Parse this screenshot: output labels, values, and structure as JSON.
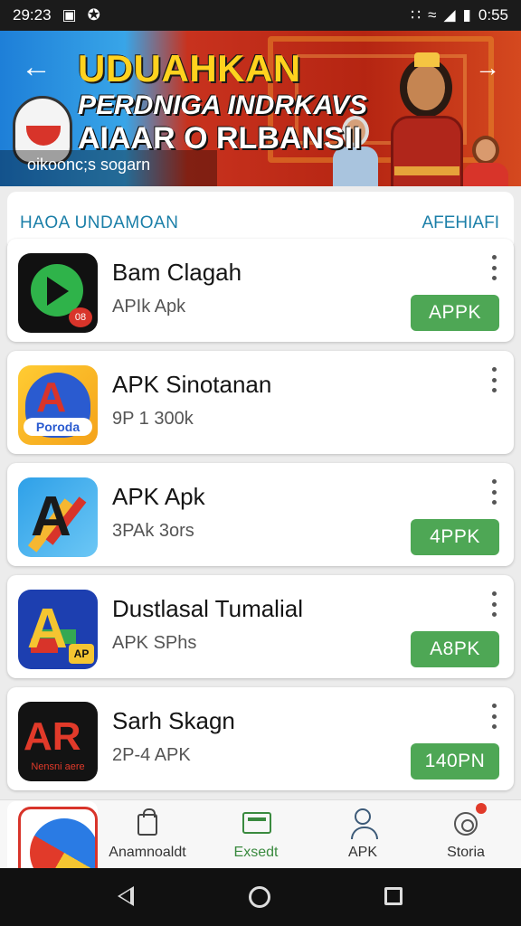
{
  "status_bar": {
    "time_left": "29:23",
    "time_right": "0:55"
  },
  "banner": {
    "headline": "UDUAHKAN",
    "line2": "PERDNIGA INDRKAVS",
    "line3": "AIAAR O RLBANSII",
    "caption": "oikoonc;s sogarn"
  },
  "section": {
    "title": "HAOA UNDAMOAN",
    "more": "AFEHIAFI"
  },
  "apps": [
    {
      "name": "Bam Clagah",
      "meta": "APIk Apk",
      "button": "APPK",
      "icon": "green-play-icon",
      "badge": "08"
    },
    {
      "name": "APK Sinotanan",
      "meta": "9P 1 300k",
      "button": "",
      "icon": "shield-a-icon",
      "badge": "Poroda"
    },
    {
      "name": "APK Apk",
      "meta": "3PAk 3ors",
      "button": "4PPK",
      "icon": "colorful-a-icon",
      "badge": ""
    },
    {
      "name": "Dustlasal Tumalial",
      "meta": "APK SPhs",
      "button": "A8PK",
      "icon": "blue-a-icon",
      "badge": "AP"
    },
    {
      "name": "Sarh Skagn",
      "meta": "2P-4 APK",
      "button": "140PN",
      "icon": "ar-icon",
      "badge": "Nensni aere",
      "mark": "AR"
    }
  ],
  "tabs": [
    {
      "label": "Anamnoaldt",
      "icon": "shopping-bag-icon"
    },
    {
      "label": "Exsedt",
      "icon": "card-icon"
    },
    {
      "label": "APK",
      "icon": "person-icon"
    },
    {
      "label": "Storia",
      "icon": "camera-icon"
    }
  ],
  "colors": {
    "accent_green": "#4ea755",
    "section_blue": "#1b7fa8",
    "headline_yellow": "#ffd21e"
  }
}
